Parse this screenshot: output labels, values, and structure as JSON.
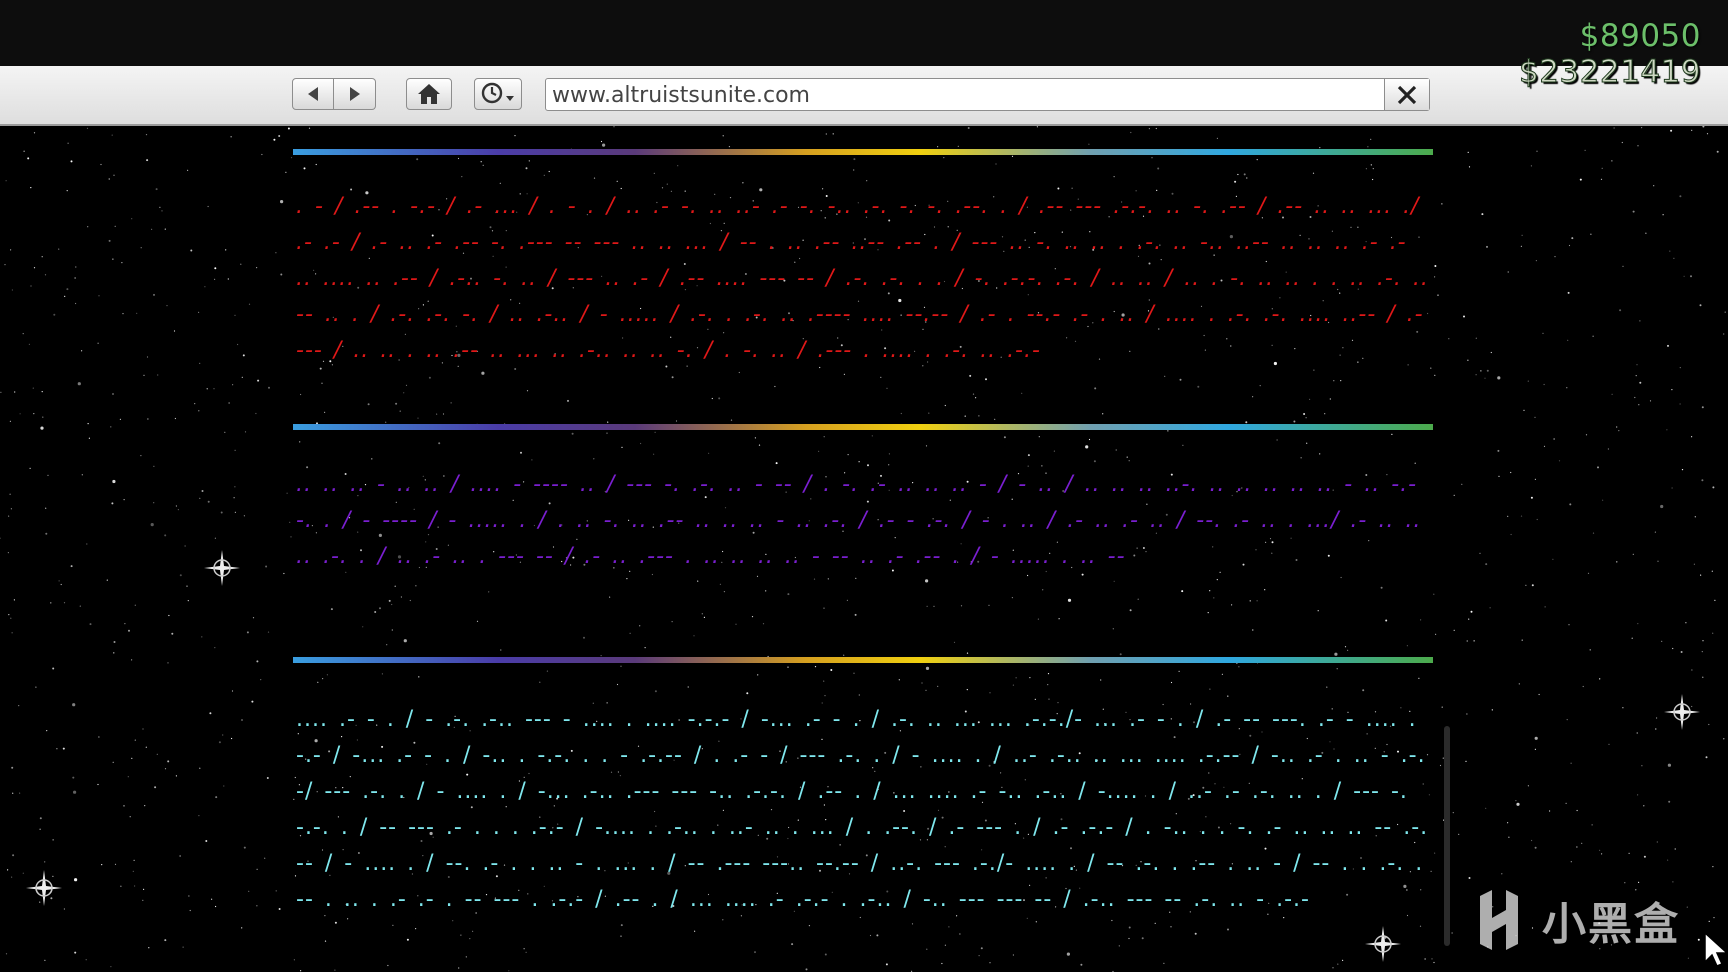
{
  "hud": {
    "wallet_cash": "$89050",
    "bank_cash": "$23221419"
  },
  "browser": {
    "url": "www.altruistsunite.com",
    "icons": [
      "back-arrow-icon",
      "forward-arrow-icon",
      "home-icon",
      "history-clock-icon",
      "close-icon"
    ]
  },
  "page": {
    "morse_blocks": [
      {
        "color": "#e01818",
        "text": ". - / .-- . -.- / .- ... / . - . / .. .- -. .. ..- .- -. -.. .-. -. -. .--. . / .-- --- .-.-. .. -. .-- / .-- .. .. ... ./ .- .- / .- .. .- .-- -. .--- -- --- .. .. ... / -- . .. .-- ..-- .-- . / --- .. -. .. .. . .-. .. -.. ..-- .. .. .. .- .- .. .... .. .-- / .-.. -. .. / --- .. .- / .-- .... --- -- / .-. .-. . . / -. .-.-. .-. / .. .. / .. . -. .. .. . . .. .-. .. -- .. . / .-. .-. -. / .. .-.. / - ..... / .-. . .-. .. .---- .... --.-- / .- . --.- .- . .. / .... . .-. .-. .... ..-- / .---- / .. .. . .. .-- .. ... .. .-.. .. .. -. / . -. .. / .--- . .... . .-. .. .-.-"
      },
      {
        "color": "#7a1fd0",
        "text": ".. .. .. - .. .. / .... - ---- .. / --- -. .-. .. - -- / . -. .- .. .. .. - / - .. / .. .. .. ..-. .. .. .. .. .. - .. -.--. . / - ---- / - ..... . / . .. -. .. .-- .. .. .. - .. .-. / .- - .-. / - . .. / .- .. .- .. / --. .- .. . .../ .- .. .. .. .-. . / .. .- .. . --- -- / .- .. .--- . .. .. .. .. - -- .. .- .-- . / - ..... . .. --"
      },
      {
        "color": "#7fe8ee",
        "text": ".... .- - . / - .-. .-.. --- - .... . .... -.-.- / -... .- - . / .-. .. ... ... .-.-./- ... .- - . / .- -- ---. .- - .... .-.- / -... .- - . / -.. . -.-. . . - .-.-- / . .- - / --- .-. . / - .... . / ..- .-.. .. ... .... .-.-- / -.. .- . .. - .-.-/ --- .-. . / - .... . / -... .-.. .--- --- -.. .-.-. / .-- . / ... .... .- -.. .-.. / -.... . / ..- .- .-. .. . / --- -. -.-. . / -- --- .- . . . .-.- / -.... . .-.. . ..- .. . ... / . .--. / .- --- . / .- .-.- / . -.. . . -. .- .. .. .. -- .-.-- / - .... . / --. .- . . .. - . ... . / -- .--- ---.. --.-- / ..-. --- .-./- .... . / -- .-. . .-- . .. - / -- . . .-. . -- . .. . .- .- . -- --- . .-.- / .-- . / ... .... .- .-.- . .-.. / -.. --- --- -- / .-.. --- -- .-. .. - .-.-"
      }
    ]
  },
  "watermark": {
    "text": "小黑盒"
  }
}
